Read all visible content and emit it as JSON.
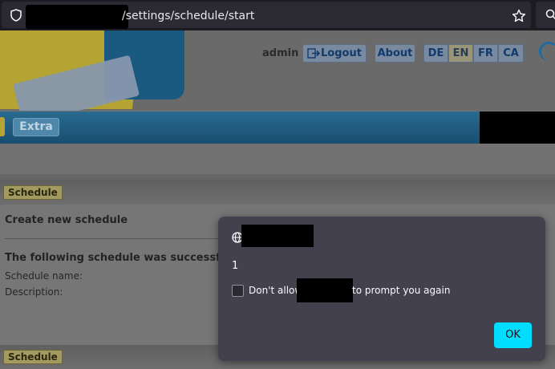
{
  "browser": {
    "url_visible": "/settings/schedule/start"
  },
  "header": {
    "user": "admin",
    "logout_label": "Logout",
    "about_label": "About",
    "languages": [
      "DE",
      "EN",
      "FR",
      "CA"
    ],
    "active_language": "EN"
  },
  "nav": {
    "extra_label": "Extra"
  },
  "sections": {
    "top_tag": "Schedule",
    "bottom_tag": "Schedule"
  },
  "content": {
    "title": "Create new schedule",
    "success_text": "The following schedule was successfully c",
    "schedule_name_label": "Schedule name:",
    "description_label": "Description:"
  },
  "dialog": {
    "message": "1",
    "checkbox_text_before": "Don't allow",
    "checkbox_text_after": "to prompt you again",
    "ok_label": "OK"
  },
  "colors": {
    "accent_dialog_button": "#00ddff",
    "nav_blue": "#1f5f86",
    "browser_chrome": "#1c1b22"
  }
}
